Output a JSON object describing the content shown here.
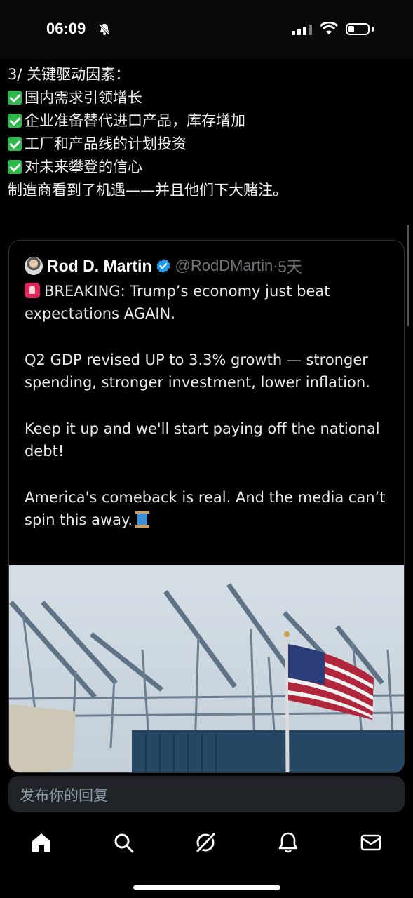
{
  "status_bar": {
    "time": "06:09",
    "battery_level": 0.3
  },
  "post": {
    "heading": "3/ 关键驱动因素：",
    "checklist": [
      "国内需求引领增长",
      "企业准备替代进口产品，库存增加",
      "工厂和产品线的计划投资",
      "对未来攀登的信心"
    ],
    "conclusion": "制造商看到了机遇——并且他们下大赌注。"
  },
  "quote": {
    "author_name": "Rod D. Martin",
    "handle": "@RodDMartin",
    "separator": "·",
    "time": "5天",
    "paragraphs": [
      "BREAKING: Trump’s economy just beat expectations AGAIN.",
      "Q2 GDP revised UP to 3.3% growth — stronger spending, stronger investment, lower inflation.",
      "Keep it up and we'll start paying off the national debt!",
      "America's comeback is real. And the media can’t spin this away."
    ],
    "icons": {
      "breaking": "rotating-light-icon",
      "thread": "thread-spool-icon"
    },
    "image": {
      "subject": "port-cranes-with-us-flag"
    }
  },
  "reply": {
    "placeholder": "发布你的回复"
  },
  "tabs": [
    {
      "icon": "home-icon"
    },
    {
      "icon": "search-icon"
    },
    {
      "icon": "grok-icon"
    },
    {
      "icon": "notifications-icon"
    },
    {
      "icon": "messages-icon"
    }
  ],
  "colors": {
    "background": "#000000",
    "text": "#e7e9ea",
    "secondary": "#71767b",
    "verified": "#1d9bf0",
    "check": "#2fb84c"
  }
}
